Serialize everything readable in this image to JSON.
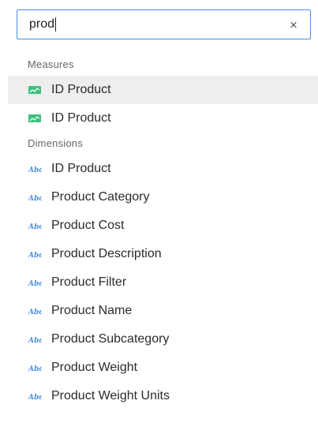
{
  "search": {
    "value": "prod",
    "clear_label": "×"
  },
  "sections": {
    "measures": {
      "heading": "Measures",
      "items": [
        {
          "label": "ID Product",
          "icon": "measure-icon"
        },
        {
          "label": "ID Product",
          "icon": "measure-icon"
        }
      ]
    },
    "dimensions": {
      "heading": "Dimensions",
      "items": [
        {
          "label": "ID Product",
          "icon": "text-dimension-icon"
        },
        {
          "label": "Product Category",
          "icon": "text-dimension-icon"
        },
        {
          "label": "Product Cost",
          "icon": "text-dimension-icon"
        },
        {
          "label": "Product Description",
          "icon": "text-dimension-icon"
        },
        {
          "label": "Product Filter",
          "icon": "text-dimension-icon"
        },
        {
          "label": "Product Name",
          "icon": "text-dimension-icon"
        },
        {
          "label": "Product Subcategory",
          "icon": "text-dimension-icon"
        },
        {
          "label": "Product Weight",
          "icon": "text-dimension-icon"
        },
        {
          "label": "Product Weight Units",
          "icon": "text-dimension-icon"
        }
      ]
    }
  },
  "colors": {
    "focus_border": "#4a90e2",
    "measure_icon": "#3dbf7e",
    "dimension_icon": "#4a90e2",
    "active_row": "#eeeeee"
  },
  "icon_text": {
    "dimension": "Abc"
  }
}
